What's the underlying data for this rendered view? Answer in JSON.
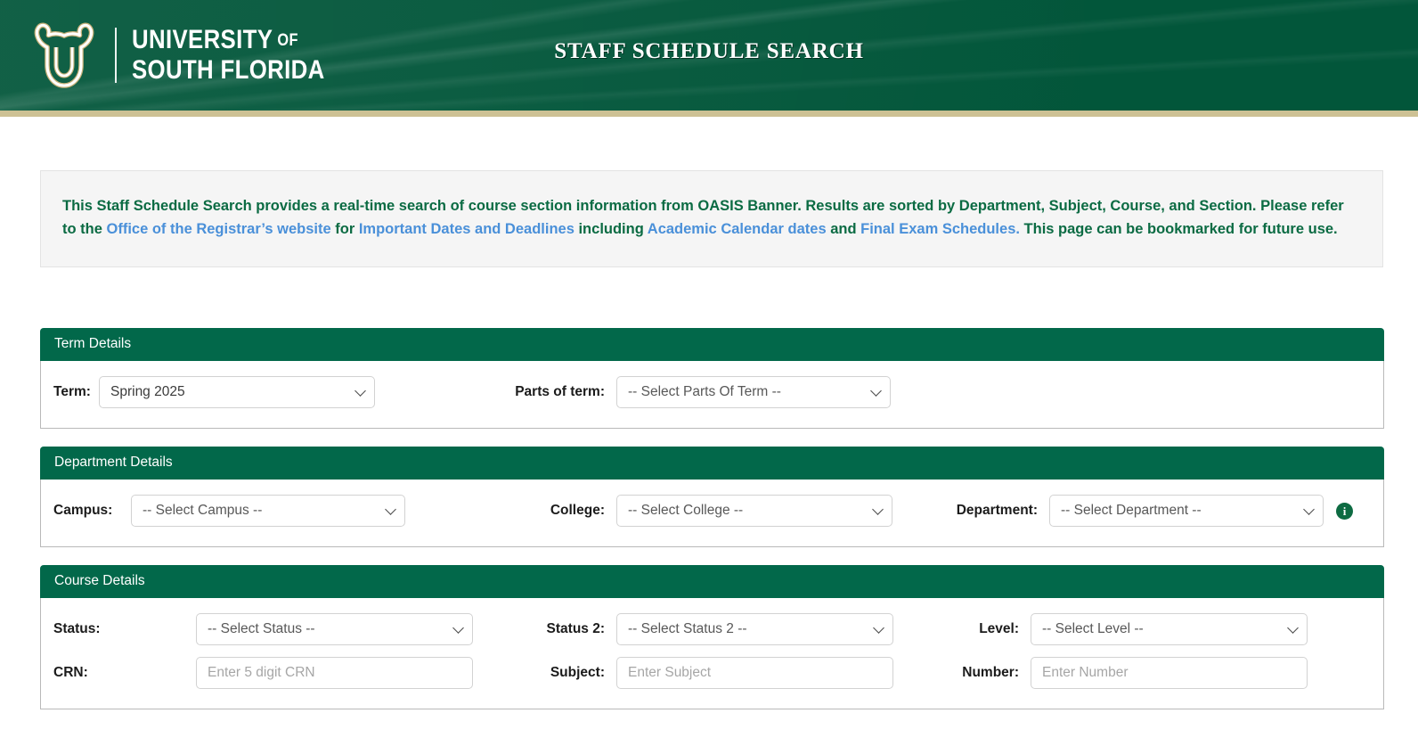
{
  "header": {
    "title": "STAFF SCHEDULE SEARCH",
    "logo": {
      "icon": "usf-bull-logo",
      "line1": "UNIVERSITY",
      "of": "OF",
      "line2": "SOUTH FLORIDA"
    },
    "accent_green": "#02563a",
    "accent_gold": "#cdc194"
  },
  "info_banner": {
    "seg1": "This Staff Schedule Search provides a real-time search of course section information from OASIS Banner. Results are sorted by Department, Subject, Course, and Section. Please refer to the ",
    "link1": "Office of the Registrar’s website",
    "seg2": " for ",
    "link2": "Important Dates and Deadlines",
    "seg3": " including ",
    "link3": "Academic Calendar dates",
    "seg4": " and ",
    "link4": "Final Exam Schedules.",
    "seg5": " This page can be bookmarked for future use.",
    "text_color": "#0b6b43",
    "link_color": "#4a90d9"
  },
  "sections": {
    "term": {
      "heading": "Term Details",
      "term_label": "Term:",
      "term_value": "Spring 2025",
      "parts_label": "Parts of term:",
      "parts_value": "-- Select Parts Of Term --"
    },
    "department": {
      "heading": "Department Details",
      "campus_label": "Campus:",
      "campus_value": "-- Select Campus --",
      "college_label": "College:",
      "college_value": "-- Select College --",
      "department_label": "Department:",
      "department_value": "-- Select Department --",
      "info_icon": "info-circle-icon"
    },
    "course": {
      "heading": "Course Details",
      "status_label": "Status:",
      "status_value": "-- Select Status --",
      "status2_label": "Status 2:",
      "status2_value": "-- Select Status 2 --",
      "level_label": "Level:",
      "level_value": "-- Select Level --",
      "crn_label": "CRN:",
      "crn_value": "",
      "crn_placeholder": "Enter 5 digit CRN",
      "subject_label": "Subject:",
      "subject_value": "",
      "subject_placeholder": "Enter Subject",
      "number_label": "Number:",
      "number_value": "",
      "number_placeholder": "Enter Number"
    }
  }
}
